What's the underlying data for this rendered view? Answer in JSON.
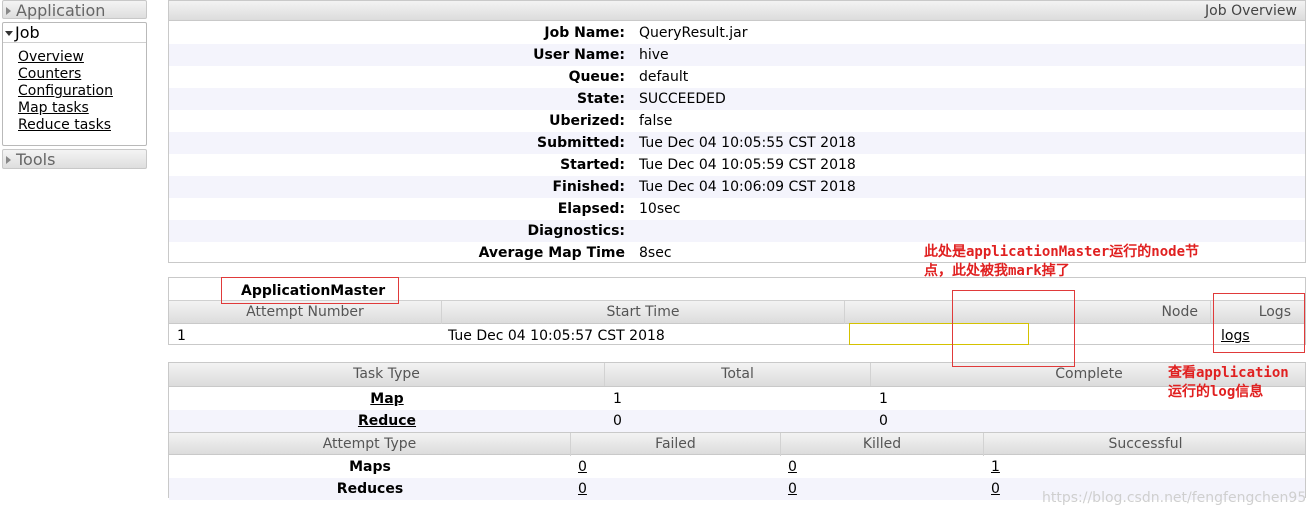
{
  "sidebar": {
    "application_label": "Application",
    "job_label": "Job",
    "job_links": [
      "Overview",
      "Counters",
      "Configuration",
      "Map tasks",
      "Reduce tasks"
    ],
    "tools_label": "Tools"
  },
  "overview": {
    "title": "Job Overview",
    "rows": [
      {
        "key": "Job Name:",
        "value": "QueryResult.jar"
      },
      {
        "key": "User Name:",
        "value": "hive"
      },
      {
        "key": "Queue:",
        "value": "default"
      },
      {
        "key": "State:",
        "value": "SUCCEEDED"
      },
      {
        "key": "Uberized:",
        "value": "false"
      },
      {
        "key": "Submitted:",
        "value": "Tue Dec 04 10:05:55 CST 2018"
      },
      {
        "key": "Started:",
        "value": "Tue Dec 04 10:05:59 CST 2018"
      },
      {
        "key": "Finished:",
        "value": "Tue Dec 04 10:06:09 CST 2018"
      },
      {
        "key": "Elapsed:",
        "value": "10sec"
      },
      {
        "key": "Diagnostics:",
        "value": ""
      },
      {
        "key": "Average Map Time",
        "value": "8sec"
      }
    ]
  },
  "am": {
    "title": "ApplicationMaster",
    "headers": [
      "Attempt Number",
      "Start Time",
      "Node",
      "Logs"
    ],
    "row": {
      "attempt": "1",
      "start": "Tue Dec 04 10:05:57 CST 2018",
      "node": "",
      "logs": "logs"
    }
  },
  "tasks": {
    "headers": [
      "Task Type",
      "Total",
      "Complete"
    ],
    "rows": [
      {
        "type": "Map",
        "total": "1",
        "complete": "1"
      },
      {
        "type": "Reduce",
        "total": "0",
        "complete": "0"
      }
    ],
    "attempt_headers": [
      "Attempt Type",
      "Failed",
      "Killed",
      "Successful"
    ],
    "attempt_rows": [
      {
        "type": "Maps",
        "failed": "0",
        "killed": "0",
        "successful": "1"
      },
      {
        "type": "Reduces",
        "failed": "0",
        "killed": "0",
        "successful": "0"
      }
    ]
  },
  "annotations": {
    "node_note_line1": "此处是applicationMaster运行的node节",
    "node_note_line2": "点，此处被我mark掉了",
    "log_note_line1": "查看application",
    "log_note_line2": "运行的log信息"
  },
  "watermark": "https://blog.csdn.net/fengfengchen95",
  "colors": {
    "annotation": "#e02020",
    "header_bg": "#e4e4e4",
    "alt_row": "#f4f4fc"
  }
}
